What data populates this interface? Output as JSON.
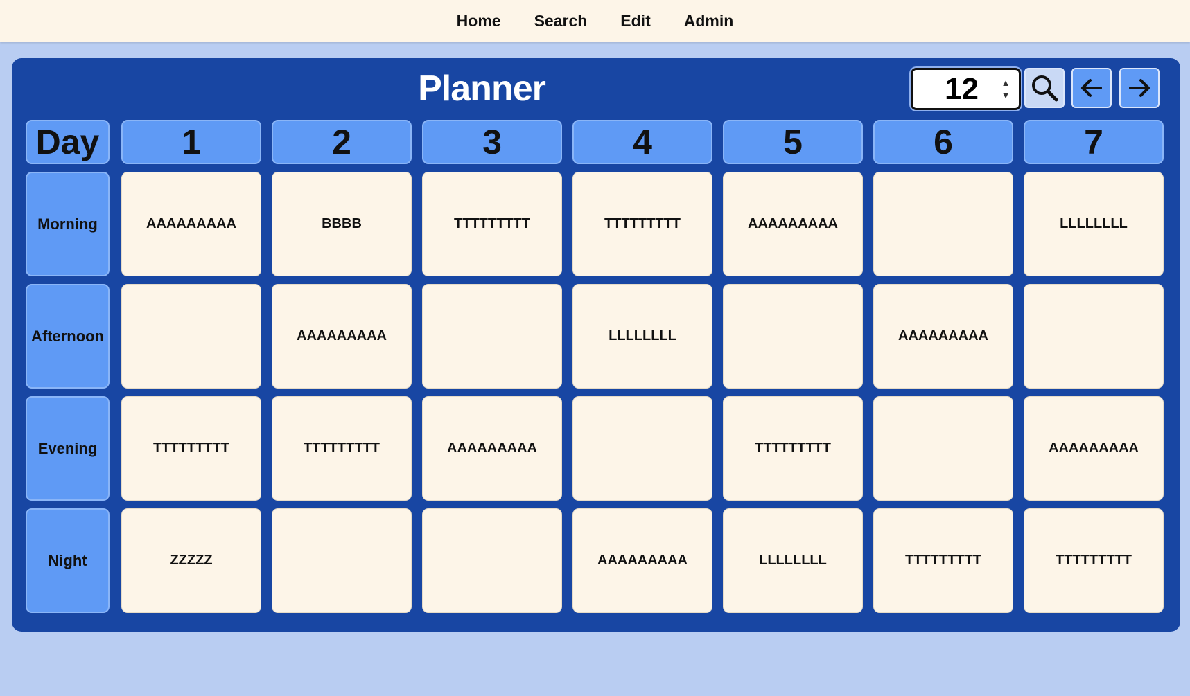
{
  "nav": {
    "items": [
      "Home",
      "Search",
      "Edit",
      "Admin"
    ]
  },
  "planner": {
    "title": "Planner",
    "week_value": "12",
    "spin_up": "▲",
    "spin_down": "▼",
    "corner_label": "Day",
    "days": [
      "1",
      "2",
      "3",
      "4",
      "5",
      "6",
      "7"
    ],
    "periods": [
      "Morning",
      "Afternoon",
      "Evening",
      "Night"
    ],
    "grid": [
      [
        "AAAAAAAAA",
        "BBBB",
        "TTTTTTTTT",
        "TTTTTTTTT",
        "AAAAAAAAA",
        "",
        "LLLLLLLL"
      ],
      [
        "",
        "AAAAAAAAA",
        "",
        "LLLLLLLL",
        "",
        "AAAAAAAAA",
        ""
      ],
      [
        "TTTTTTTTT",
        "TTTTTTTTT",
        "AAAAAAAAA",
        "",
        "TTTTTTTTT",
        "",
        "AAAAAAAAA"
      ],
      [
        "ZZZZZ",
        "",
        "",
        "AAAAAAAAA",
        "LLLLLLLL",
        "TTTTTTTTT",
        "TTTTTTTTT"
      ]
    ]
  },
  "icons": {
    "search": "magnifier-icon",
    "prev": "arrow-left-icon",
    "next": "arrow-right-icon"
  },
  "colors": {
    "panel": "#1846a3",
    "header_cell": "#5f9af5",
    "slot_cell": "#fdf5e8",
    "page_background": "#b9cdf2",
    "nav_background": "#fdf5e8"
  }
}
